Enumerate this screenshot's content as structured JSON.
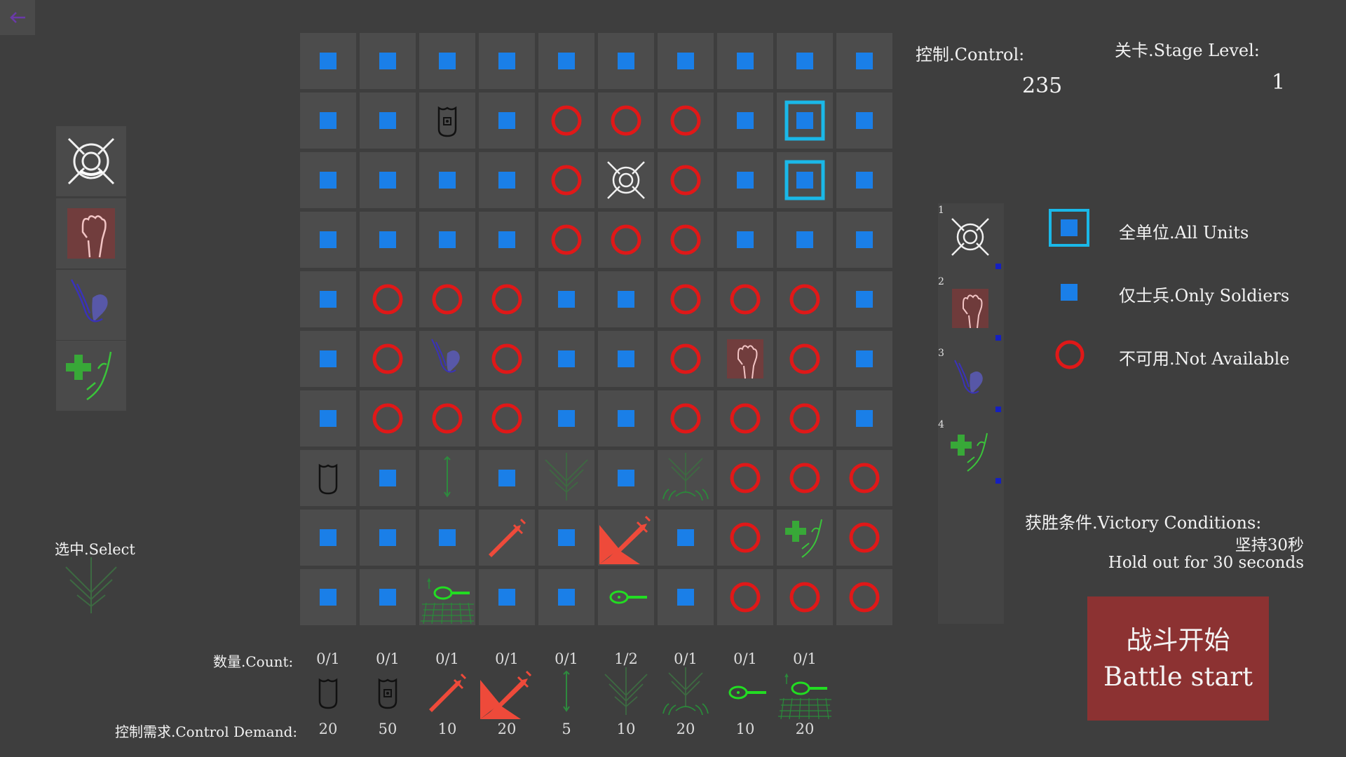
{
  "header": {
    "control_label": "控制.Control:",
    "control_value": "235",
    "stage_label": "关卡.Stage Level:",
    "stage_value": "1"
  },
  "back_button": {
    "icon": "back-arrow-icon"
  },
  "unit_bar": [
    {
      "icon": "target-crosshair-icon"
    },
    {
      "icon": "fist-icon"
    },
    {
      "icon": "heart-hand-icon"
    },
    {
      "icon": "heal-hand-icon"
    }
  ],
  "select": {
    "label": "选中.Select",
    "icon": "arrow-rain-icon"
  },
  "grid": {
    "rows": [
      [
        "soldier",
        "soldier",
        "soldier",
        "soldier",
        "soldier",
        "soldier",
        "soldier",
        "soldier",
        "soldier",
        "soldier"
      ],
      [
        "soldier",
        "soldier",
        "shield-eye",
        "soldier",
        "blocked",
        "blocked",
        "blocked",
        "soldier",
        "all",
        "soldier"
      ],
      [
        "soldier",
        "soldier",
        "soldier",
        "soldier",
        "blocked",
        "target",
        "blocked",
        "soldier",
        "all",
        "soldier"
      ],
      [
        "soldier",
        "soldier",
        "soldier",
        "soldier",
        "blocked",
        "blocked",
        "blocked",
        "soldier",
        "soldier",
        "soldier"
      ],
      [
        "soldier",
        "blocked",
        "blocked",
        "blocked",
        "soldier",
        "soldier",
        "blocked",
        "blocked",
        "blocked",
        "soldier"
      ],
      [
        "soldier",
        "blocked",
        "heart-hand",
        "blocked",
        "soldier",
        "soldier",
        "blocked",
        "fist",
        "blocked",
        "soldier"
      ],
      [
        "soldier",
        "blocked",
        "blocked",
        "blocked",
        "soldier",
        "soldier",
        "blocked",
        "blocked",
        "blocked",
        "soldier"
      ],
      [
        "shield",
        "soldier",
        "arrow",
        "soldier",
        "arrow-rain",
        "soldier",
        "arrow-storm",
        "blocked",
        "blocked",
        "blocked"
      ],
      [
        "soldier",
        "soldier",
        "soldier",
        "sword",
        "soldier",
        "sword-big",
        "soldier",
        "blocked",
        "heal-hand",
        "blocked"
      ],
      [
        "soldier",
        "soldier",
        "racket-field",
        "soldier",
        "soldier",
        "racket",
        "soldier",
        "blocked",
        "blocked",
        "blocked"
      ]
    ]
  },
  "counts": {
    "count_label": "数量.Count:",
    "demand_label": "控制需求.Control Demand:",
    "items": [
      {
        "icon": "shield",
        "count": "0/1",
        "demand": "20"
      },
      {
        "icon": "shield-eye",
        "count": "0/1",
        "demand": "50"
      },
      {
        "icon": "sword",
        "count": "0/1",
        "demand": "10"
      },
      {
        "icon": "sword-big",
        "count": "0/1",
        "demand": "20"
      },
      {
        "icon": "arrow",
        "count": "0/1",
        "demand": "5"
      },
      {
        "icon": "arrow-rain",
        "count": "1/2",
        "demand": "10"
      },
      {
        "icon": "arrow-storm",
        "count": "0/1",
        "demand": "20"
      },
      {
        "icon": "racket",
        "count": "0/1",
        "demand": "10"
      },
      {
        "icon": "racket-field",
        "count": "0/1",
        "demand": "20"
      }
    ]
  },
  "legend": {
    "units": [
      {
        "num": "1",
        "icon": "target"
      },
      {
        "num": "2",
        "icon": "fist"
      },
      {
        "num": "3",
        "icon": "heart-hand"
      },
      {
        "num": "4",
        "icon": "heal-hand"
      }
    ],
    "all_units": "全单位.All Units",
    "only_soldiers": "仅士兵.Only Soldiers",
    "not_available": "不可用.Not Available"
  },
  "victory": {
    "label": "获胜条件.Victory Conditions:",
    "line1": "坚持30秒",
    "line2": "Hold out for 30 seconds"
  },
  "battle_button": {
    "line1": "战斗开始",
    "line2": "Battle start"
  },
  "colors": {
    "background": "#3e3e3e",
    "soldier_marker": "#1a7fe8",
    "all_units_frame": "#1ab8e8",
    "blocked_ring": "#e01818",
    "battle_button": "#8c3232"
  }
}
